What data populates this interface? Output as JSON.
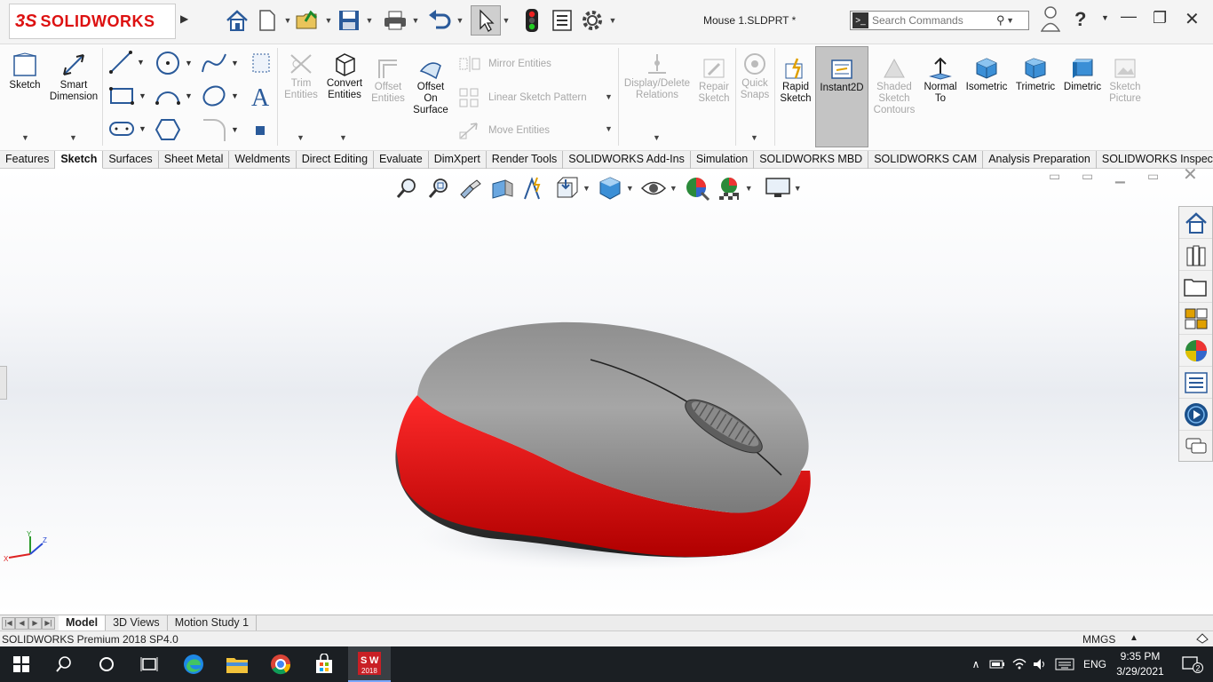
{
  "app": {
    "brand_ds": "3S",
    "brand_name": "SOLIDWORKS",
    "document_title": "Mouse 1.SLDPRT *"
  },
  "search": {
    "placeholder": "Search Commands"
  },
  "ribbon": {
    "sketch": "Sketch",
    "smart_dimension": "Smart Dimension",
    "trim_entities": "Trim Entities",
    "convert_entities": "Convert Entities",
    "offset_entities": "Offset Entities",
    "offset_on_surface": "Offset On Surface",
    "mirror_entities": "Mirror Entities",
    "linear_sketch_pattern": "Linear Sketch Pattern",
    "move_entities": "Move Entities",
    "display_delete_relations": "Display/Delete Relations",
    "repair_sketch": "Repair Sketch",
    "quick_snaps": "Quick Snaps",
    "rapid_sketch": "Rapid Sketch",
    "instant2d": "Instant2D",
    "shaded_sketch_contours": "Shaded Sketch Contours",
    "normal_to": "Normal To",
    "isometric": "Isometric",
    "trimetric": "Trimetric",
    "dimetric": "Dimetric",
    "sketch_picture": "Sketch Picture"
  },
  "tabs": [
    "Features",
    "Sketch",
    "Surfaces",
    "Sheet Metal",
    "Weldments",
    "Direct Editing",
    "Evaluate",
    "DimXpert",
    "Render Tools",
    "SOLIDWORKS Add-Ins",
    "Simulation",
    "SOLIDWORKS MBD",
    "SOLIDWORKS CAM",
    "Analysis Preparation",
    "SOLIDWORKS Inspection"
  ],
  "active_tab": "Sketch",
  "bottom_tabs": [
    "Model",
    "3D Views",
    "Motion Study 1"
  ],
  "status": {
    "product": "SOLIDWORKS Premium 2018 SP4.0",
    "units": "MMGS"
  },
  "triad": {
    "x": "X",
    "y": "Y",
    "z": "Z"
  },
  "taskbar": {
    "sw_badge": "2018",
    "lang": "ENG",
    "time": "9:35 PM",
    "date": "3/29/2021",
    "notifications": "2"
  },
  "colors": {
    "brand_red": "#d11f26",
    "mouse_grey": "#8a8a8a",
    "mouse_red": "#e01010",
    "mouse_dark": "#3a3a3a",
    "taskbar_bg": "#1b1f23"
  }
}
